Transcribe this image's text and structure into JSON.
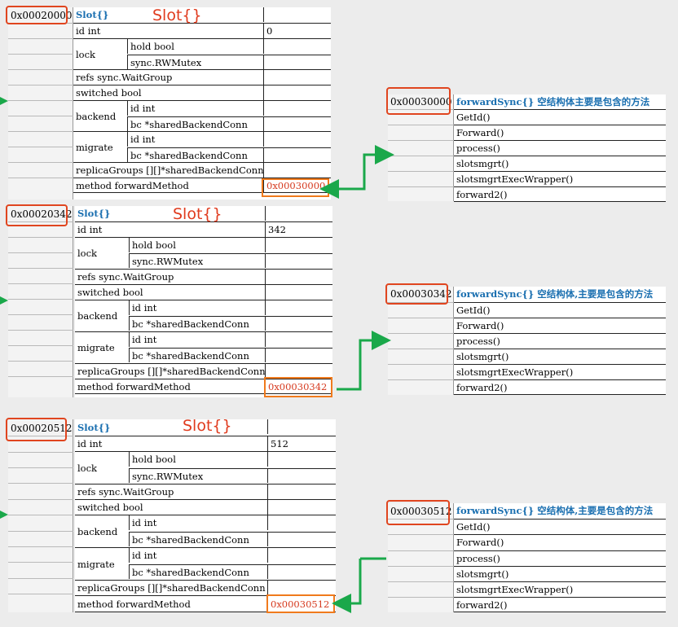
{
  "slots": [
    {
      "address": "0x00020000",
      "type_label": "Slot{}",
      "big_label": "Slot{}",
      "id_field": "id int",
      "id_value": "0",
      "lock_label": "lock",
      "lock_fields": [
        "hold bool",
        "sync.RWMutex"
      ],
      "refs": "refs sync.WaitGroup",
      "switched": "switched bool",
      "backend_label": "backend",
      "backend_fields": [
        "id int",
        "bc *sharedBackendConn"
      ],
      "migrate_label": "migrate",
      "migrate_fields": [
        "id int",
        "bc *sharedBackendConn"
      ],
      "replica": "replicaGroups [][]*sharedBackendConn",
      "method": "method forwardMethod",
      "method_value": "0x00030000"
    },
    {
      "address": "0x00020342",
      "type_label": "Slot{}",
      "big_label": "Slot{}",
      "id_field": "id int",
      "id_value": "342",
      "lock_label": "lock",
      "lock_fields": [
        "hold bool",
        "sync.RWMutex"
      ],
      "refs": "refs sync.WaitGroup",
      "switched": "switched bool",
      "backend_label": "backend",
      "backend_fields": [
        "id int",
        "bc *sharedBackendConn"
      ],
      "migrate_label": "migrate",
      "migrate_fields": [
        "id int",
        "bc *sharedBackendConn"
      ],
      "replica": "replicaGroups [][]*sharedBackendConn",
      "method": "method forwardMethod",
      "method_value": "0x00030342"
    },
    {
      "address": "0x00020512",
      "type_label": "Slot{}",
      "big_label": "Slot{}",
      "id_field": "id int",
      "id_value": "512",
      "lock_label": "lock",
      "lock_fields": [
        "hold bool",
        "sync.RWMutex"
      ],
      "refs": "refs sync.WaitGroup",
      "switched": "switched bool",
      "backend_label": "backend",
      "backend_fields": [
        "id int",
        "bc *sharedBackendConn"
      ],
      "migrate_label": "migrate",
      "migrate_fields": [
        "id int",
        "bc *sharedBackendConn"
      ],
      "replica": "replicaGroups [][]*sharedBackendConn",
      "method": "method forwardMethod",
      "method_value": "0x00030512"
    }
  ],
  "forwards": [
    {
      "address": "0x00030000",
      "title": "forwardSync{} 空结构体主要是包含的方法",
      "methods": [
        "GetId()",
        "Forward()",
        "process()",
        "slotsmgrt()",
        "slotsmgrtExecWrapper()",
        "forward2()"
      ]
    },
    {
      "address": "0x00030342",
      "title": "forwardSync{} 空结构体,主要是包含的方法",
      "methods": [
        "GetId()",
        "Forward()",
        "process()",
        "slotsmgrt()",
        "slotsmgrtExecWrapper()",
        "forward2()"
      ]
    },
    {
      "address": "0x00030512",
      "title": "forwardSync{} 空结构体,主要是包含的方法",
      "methods": [
        "GetId()",
        "Forward()",
        "process()",
        "slotsmgrt()",
        "slotsmgrtExecWrapper()",
        "forward2()"
      ]
    }
  ],
  "colors": {
    "accent_red": "#e0451f",
    "accent_orange": "#f07a1c",
    "arrow_green": "#1aa84a",
    "title_blue": "#1a6fb0"
  }
}
